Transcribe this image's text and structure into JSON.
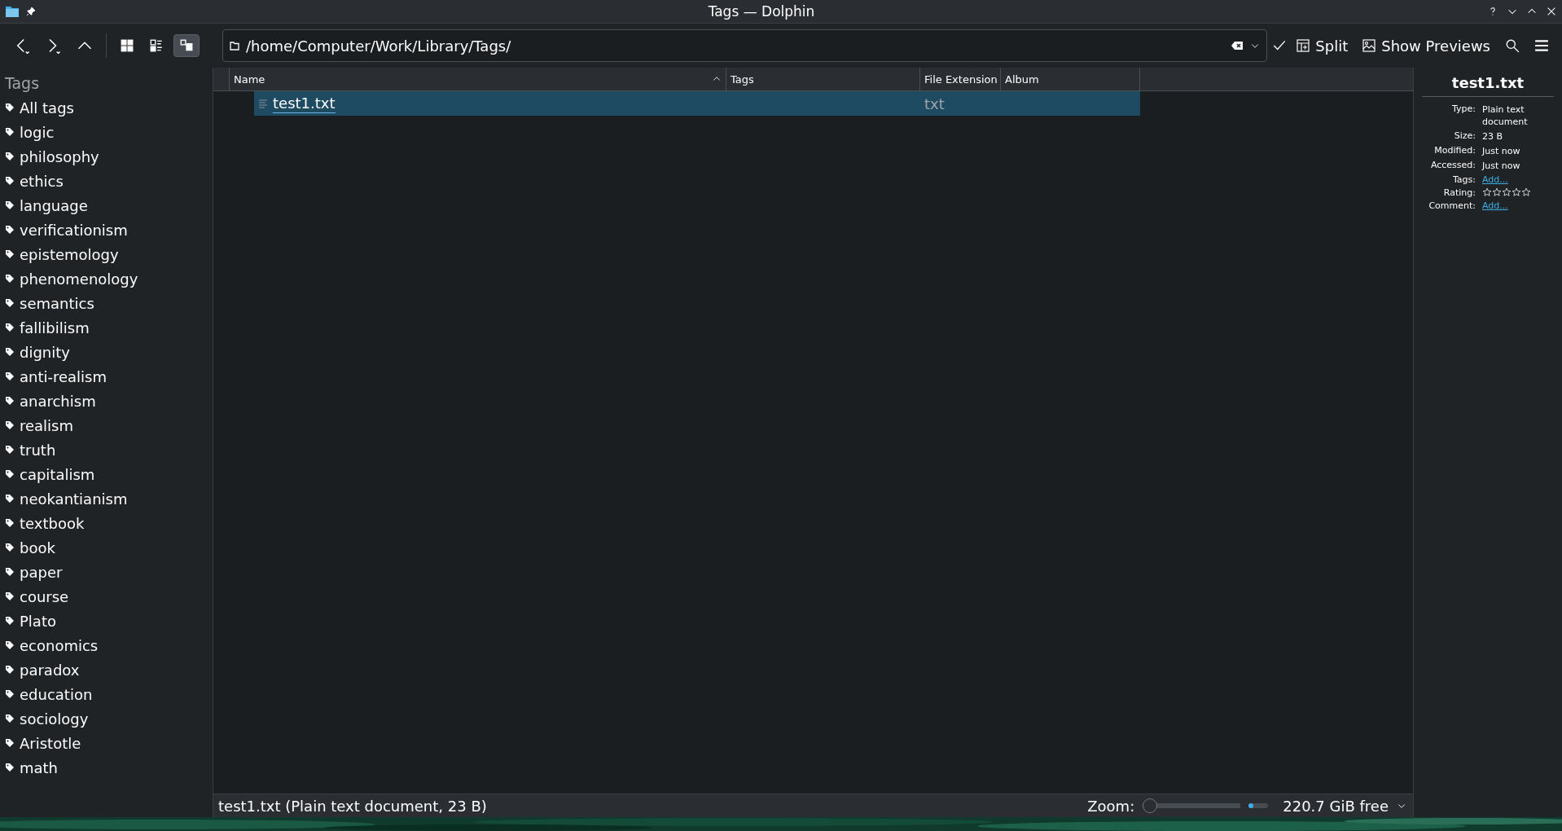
{
  "window": {
    "title": "Tags — Dolphin"
  },
  "toolbar": {
    "view_modes": [
      {
        "selected": false
      },
      {
        "selected": false
      },
      {
        "selected": true
      }
    ],
    "location": "/home/Computer/Work/Library/Tags/",
    "buttons": [
      "Split",
      "Show Previews"
    ]
  },
  "sidebar": {
    "heading": "Tags",
    "items": [
      {
        "label": "All tags"
      },
      {
        "label": "logic"
      },
      {
        "label": "philosophy"
      },
      {
        "label": "ethics"
      },
      {
        "label": "language"
      },
      {
        "label": "verificationism"
      },
      {
        "label": "epistemology"
      },
      {
        "label": "phenomenology"
      },
      {
        "label": "semantics"
      },
      {
        "label": "fallibilism"
      },
      {
        "label": "dignity"
      },
      {
        "label": "anti-realism"
      },
      {
        "label": "anarchism"
      },
      {
        "label": "realism"
      },
      {
        "label": "truth"
      },
      {
        "label": "capitalism"
      },
      {
        "label": "neokantianism"
      },
      {
        "label": "textbook"
      },
      {
        "label": "book"
      },
      {
        "label": "paper"
      },
      {
        "label": "course"
      },
      {
        "label": "Plato"
      },
      {
        "label": "economics"
      },
      {
        "label": "paradox"
      },
      {
        "label": "education"
      },
      {
        "label": "sociology"
      },
      {
        "label": "Aristotle"
      },
      {
        "label": "math"
      }
    ]
  },
  "table": {
    "columns": [
      "Name",
      "Tags",
      "File Extension",
      "Album"
    ],
    "rows": [
      {
        "name": "test1.txt",
        "extension": "txt",
        "selected": true
      }
    ]
  },
  "info_panel": {
    "title": "test1.txt",
    "fields": [
      {
        "kind": "text",
        "label": "Type:",
        "value": "Plain text document"
      },
      {
        "kind": "text",
        "label": "Size:",
        "value": "23 B"
      },
      {
        "kind": "text",
        "label": "Modified:",
        "value": "Just now"
      },
      {
        "kind": "text",
        "label": "Accessed:",
        "value": "Just now"
      },
      {
        "kind": "link",
        "label": "Tags:",
        "value": "Add..."
      },
      {
        "kind": "rating",
        "label": "Rating:",
        "stars": 0
      },
      {
        "kind": "link",
        "label": "Comment:",
        "value": "Add..."
      }
    ]
  },
  "status_bar": {
    "text": "test1.txt (Plain text document, 23 B)",
    "zoom_label": "Zoom:",
    "zoom": {
      "level": 0
    },
    "preview_size": {
      "level": 0.15
    },
    "free_space": "220.7 GiB free"
  }
}
